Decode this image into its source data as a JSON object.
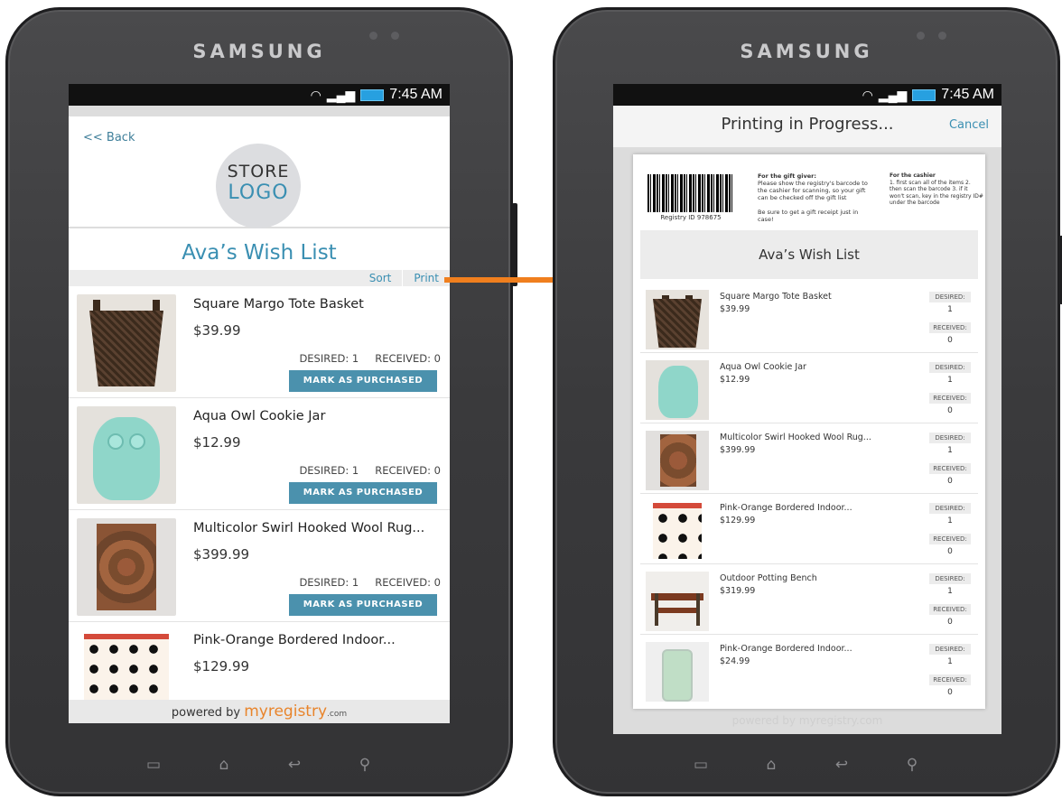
{
  "devices": {
    "brand": "SAMSUNG"
  },
  "status": {
    "time": "7:45 AM"
  },
  "left": {
    "back": "<< Back",
    "logo": {
      "line1": "STORE",
      "line2": "LOGO"
    },
    "list_title": "Ava’s Wish List",
    "toolbar": {
      "sort": "Sort",
      "print": "Print"
    },
    "items": [
      {
        "name": "Square Margo Tote Basket",
        "price": "$39.99",
        "desired": "DESIRED: 1",
        "received": "RECEIVED: 0",
        "button": "MARK AS PURCHASED"
      },
      {
        "name": "Aqua Owl Cookie Jar",
        "price": "$12.99",
        "desired": "DESIRED: 1",
        "received": "RECEIVED: 0",
        "button": "MARK AS PURCHASED"
      },
      {
        "name": "Multicolor Swirl Hooked Wool Rug...",
        "price": "$399.99",
        "desired": "DESIRED: 1",
        "received": "RECEIVED: 0",
        "button": "MARK AS PURCHASED"
      },
      {
        "name": "Pink-Orange Bordered Indoor...",
        "price": "$129.99"
      }
    ],
    "footer": {
      "prefix": "powered by ",
      "brand": "myregistry",
      "suffix": ".com"
    }
  },
  "right": {
    "title": "Printing in Progress...",
    "cancel": "Cancel",
    "registry_id": "Registry ID 978675",
    "giver": {
      "heading": "For the gift giver:",
      "body": "Please show the registry's barcode to the cashier for scanning, so your gift can be checked off the gift list",
      "note": "Be sure to get a gift receipt just in case!"
    },
    "cashier": {
      "heading": "For the cashier",
      "body": "1. first scan all of the items 2. then scan the barcode 3. if it won't scan, key in the registry ID# under the barcode"
    },
    "list_title": "Ava’s Wish List",
    "desired_label": "DESIRED:",
    "received_label": "RECEIVED:",
    "items": [
      {
        "name": "Square Margo Tote Basket",
        "price": "$39.99",
        "desired": "1",
        "received": "0"
      },
      {
        "name": "Aqua Owl Cookie Jar",
        "price": "$12.99",
        "desired": "1",
        "received": "0"
      },
      {
        "name": "Multicolor Swirl Hooked Wool Rug...",
        "price": "$399.99",
        "desired": "1",
        "received": "0"
      },
      {
        "name": "Pink-Orange Bordered Indoor...",
        "price": "$129.99",
        "desired": "1",
        "received": "0"
      },
      {
        "name": "Outdoor Potting Bench",
        "price": "$319.99",
        "desired": "1",
        "received": "0"
      },
      {
        "name": "Pink-Orange Bordered Indoor...",
        "price": "$24.99",
        "desired": "1",
        "received": "0"
      }
    ],
    "footer": "powered by myregistry.com"
  },
  "colors": {
    "accent": "#3a8fb2",
    "button": "#4b91ad",
    "arrow": "#f07f1e",
    "brand_orange": "#e8842b"
  }
}
